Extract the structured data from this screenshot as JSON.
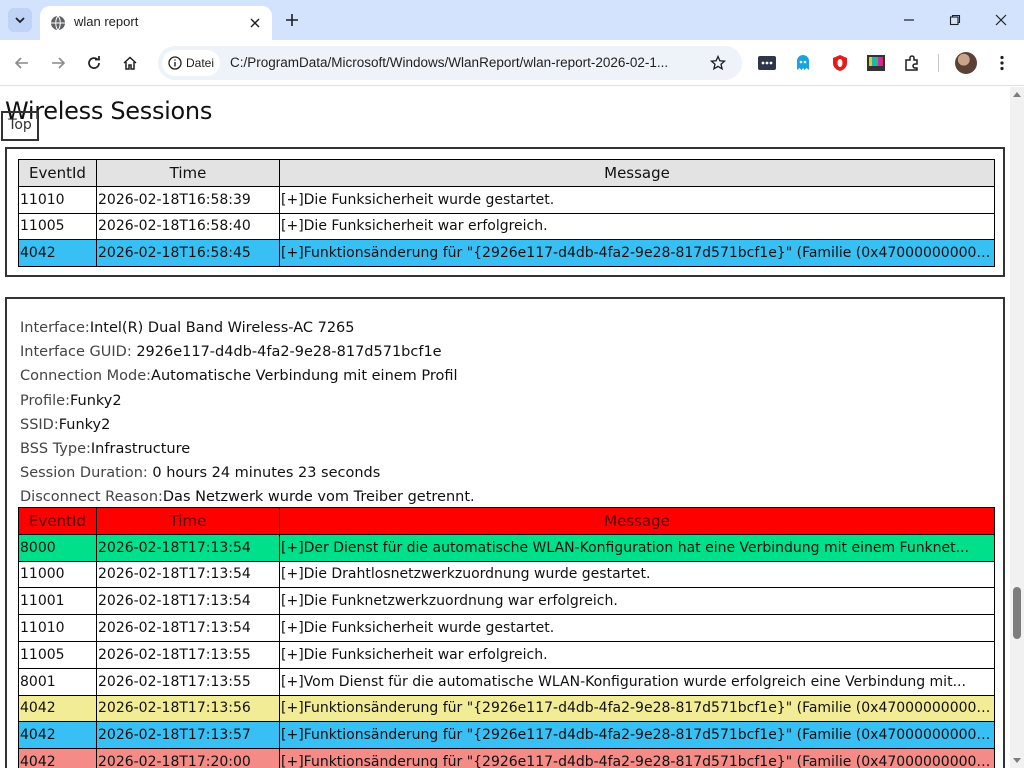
{
  "browser": {
    "tab_title": "wlan report",
    "site_chip_label": "Datei",
    "url": "C:/ProgramData/Microsoft/Windows/WlanReport/wlan-report-2026-02-1..."
  },
  "page": {
    "section_title": "Wireless Sessions",
    "top_button": "Top"
  },
  "table1": {
    "headers": [
      "EventId",
      "Time",
      "Message"
    ],
    "rows": [
      {
        "id": "11010",
        "time": "2026-02-18T16:58:39",
        "msg": "[+]Die Funksicherheit wurde gestartet.",
        "color": "white"
      },
      {
        "id": "11005",
        "time": "2026-02-18T16:58:40",
        "msg": "[+]Die Funksicherheit war erfolgreich.",
        "color": "white"
      },
      {
        "id": "4042",
        "time": "2026-02-18T16:58:45",
        "msg": "[+]Funktionsänderung für \"{2926e117-d4db-4fa2-9e28-817d571bcf1e}\" (Familie (0x470000000000...",
        "color": "blue"
      }
    ]
  },
  "session": {
    "interface_label": "Interface:",
    "interface_value": "Intel(R) Dual Band Wireless-AC 7265",
    "guid_label": "Interface GUID: ",
    "guid_value": "2926e117-d4db-4fa2-9e28-817d571bcf1e",
    "mode_label": "Connection Mode:",
    "mode_value": "Automatische Verbindung mit einem Profil",
    "profile_label": "Profile:",
    "profile_value": "Funky2",
    "ssid_label": "SSID:",
    "ssid_value": "Funky2",
    "bss_label": "BSS Type:",
    "bss_value": "Infrastructure",
    "duration_label": "Session Duration: ",
    "duration_value": "0 hours 24 minutes 23 seconds",
    "disconnect_label": "Disconnect Reason:",
    "disconnect_value": "Das Netzwerk wurde vom Treiber getrennt."
  },
  "table2": {
    "headers": [
      "EventId",
      "Time",
      "Message"
    ],
    "rows": [
      {
        "id": "8000",
        "time": "2026-02-18T17:13:54",
        "msg": "[+]Der Dienst für die automatische WLAN-Konfiguration hat eine Verbindung mit einem Funknet...",
        "color": "green"
      },
      {
        "id": "11000",
        "time": "2026-02-18T17:13:54",
        "msg": "[+]Die Drahtlosnetzwerkzuordnung wurde gestartet.",
        "color": "white"
      },
      {
        "id": "11001",
        "time": "2026-02-18T17:13:54",
        "msg": "[+]Die Funknetzwerkzuordnung war erfolgreich.",
        "color": "white"
      },
      {
        "id": "11010",
        "time": "2026-02-18T17:13:54",
        "msg": "[+]Die Funksicherheit wurde gestartet.",
        "color": "white"
      },
      {
        "id": "11005",
        "time": "2026-02-18T17:13:55",
        "msg": "[+]Die Funksicherheit war erfolgreich.",
        "color": "white"
      },
      {
        "id": "8001",
        "time": "2026-02-18T17:13:55",
        "msg": "[+]Vom Dienst für die automatische WLAN-Konfiguration wurde erfolgreich eine Verbindung mit...",
        "color": "white"
      },
      {
        "id": "4042",
        "time": "2026-02-18T17:13:56",
        "msg": "[+]Funktionsänderung für \"{2926e117-d4db-4fa2-9e28-817d571bcf1e}\" (Familie (0x470000000000...",
        "color": "yellow"
      },
      {
        "id": "4042",
        "time": "2026-02-18T17:13:57",
        "msg": "[+]Funktionsänderung für \"{2926e117-d4db-4fa2-9e28-817d571bcf1e}\" (Familie (0x470000000000...",
        "color": "blue"
      },
      {
        "id": "4042",
        "time": "2026-02-18T17:20:00",
        "msg": "[+]Funktionsänderung für \"{2926e117-d4db-4fa2-9e28-817d571bcf1e}\" (Familie (0x470000000000...",
        "color": "salmon"
      }
    ]
  },
  "colors": {
    "tabbar": "#d3e3fd",
    "header_red": "#ff0000",
    "row_blue": "#38c0f5",
    "row_green": "#00e08a",
    "row_yellow": "#f3ec96",
    "row_salmon": "#f58b86"
  },
  "icons": [
    "tab-search-icon",
    "globe-icon",
    "close-icon",
    "plus-icon",
    "minimize-icon",
    "restore-icon",
    "back-arrow-icon",
    "forward-arrow-icon",
    "reload-icon",
    "home-icon",
    "info-icon",
    "star-icon",
    "extension-icon",
    "menu-dots-icon"
  ]
}
